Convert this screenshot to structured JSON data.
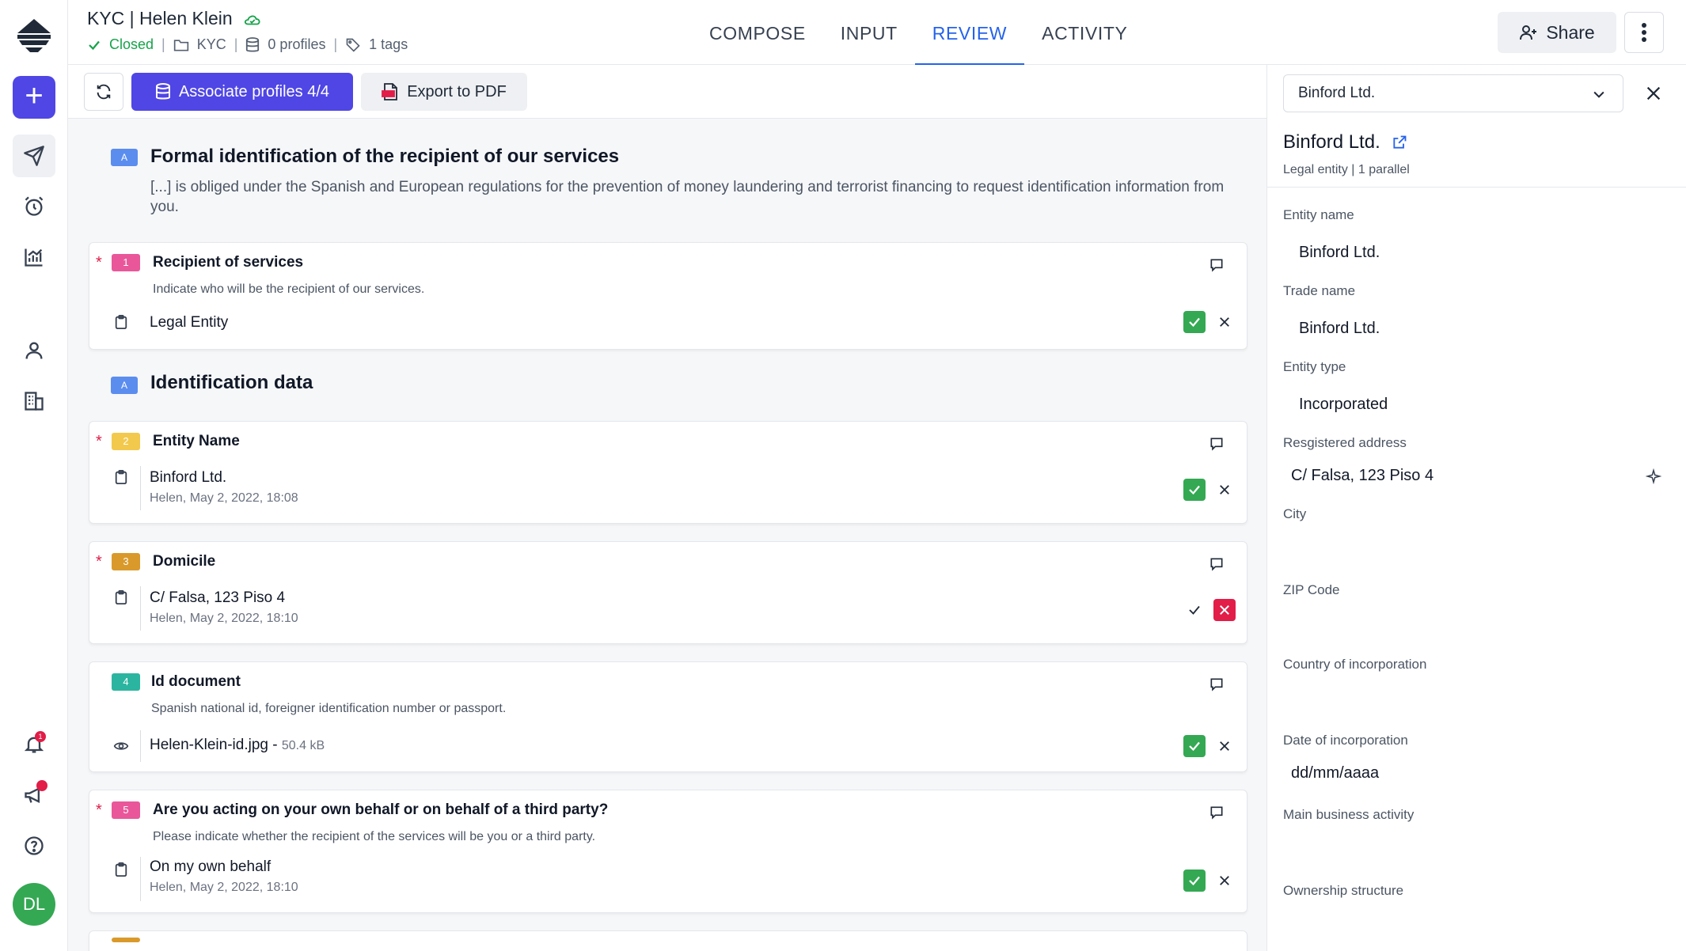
{
  "header": {
    "title": "KYC | Helen Klein",
    "status": "Closed",
    "folder": "KYC",
    "profiles": "0 profiles",
    "tags": "1 tags",
    "tabs": [
      "COMPOSE",
      "INPUT",
      "REVIEW",
      "ACTIVITY"
    ],
    "active_tab": "REVIEW",
    "share_label": "Share"
  },
  "rail": {
    "avatar_initials": "DL",
    "notification_count": "1"
  },
  "toolbar": {
    "associate_label": "Associate profiles 4/4",
    "export_label": "Export to PDF"
  },
  "sections": [
    {
      "badge": "A",
      "title": "Formal identification of the recipient of our services",
      "description": "[...] is obliged under the Spanish and European regulations for the prevention of money laundering and terrorist financing to request identification information from you."
    },
    {
      "badge": "A",
      "title": "Identification data"
    }
  ],
  "questions": [
    {
      "number": "1",
      "title": "Recipient of services",
      "required": true,
      "color": "#e9579a",
      "help": "Indicate who will be the recipient of our services.",
      "answer": "Legal Entity",
      "meta": "",
      "status": "approved"
    },
    {
      "number": "2",
      "title": "Entity Name",
      "required": true,
      "color": "#f2c94c",
      "help": "",
      "answer": "Binford Ltd.",
      "meta": "Helen, May 2, 2022, 18:08",
      "status": "approved"
    },
    {
      "number": "3",
      "title": "Domicile",
      "required": true,
      "color": "#d99a2b",
      "help": "",
      "answer": "C/ Falsa, 123 Piso 4",
      "meta": "Helen, May 2, 2022, 18:10",
      "status": "rejected"
    },
    {
      "number": "4",
      "title": "Id document",
      "required": false,
      "color": "#2bb5a0",
      "help": "Spanish national id, foreigner identification number or passport.",
      "answer": "Helen-Klein-id.jpg",
      "size": "50.4 kB",
      "meta": "",
      "status": "approved"
    },
    {
      "number": "5",
      "title": "Are you acting on your own behalf or on behalf of a third party?",
      "required": true,
      "color": "#e9579a",
      "help": "Please indicate whether the recipient of the services will be you or a third party.",
      "answer": "On my own behalf",
      "meta": "Helen, May 2, 2022, 18:10",
      "status": "approved"
    }
  ],
  "panel": {
    "selected_profile": "Binford Ltd.",
    "name": "Binford Ltd.",
    "subtitle": "Legal entity | 1 parallel",
    "fields": [
      {
        "label": "Entity name",
        "value": "Binford Ltd."
      },
      {
        "label": "Trade name",
        "value": "Binford Ltd."
      },
      {
        "label": "Entity type",
        "value": "Incorporated"
      },
      {
        "label": "Resgistered address",
        "value": "C/ Falsa, 123 Piso 4"
      },
      {
        "label": "City",
        "value": ""
      },
      {
        "label": "ZIP Code",
        "value": ""
      },
      {
        "label": "Country of incorporation",
        "value": ""
      },
      {
        "label": "Date of incorporation",
        "value": "dd/mm/aaaa"
      },
      {
        "label": "Main business activity",
        "value": ""
      },
      {
        "label": "Ownership structure",
        "value": ""
      }
    ]
  },
  "colors": {
    "accent": "#4f46e5",
    "link": "#2563eb",
    "approve": "#34a853",
    "reject": "#e11d48"
  }
}
